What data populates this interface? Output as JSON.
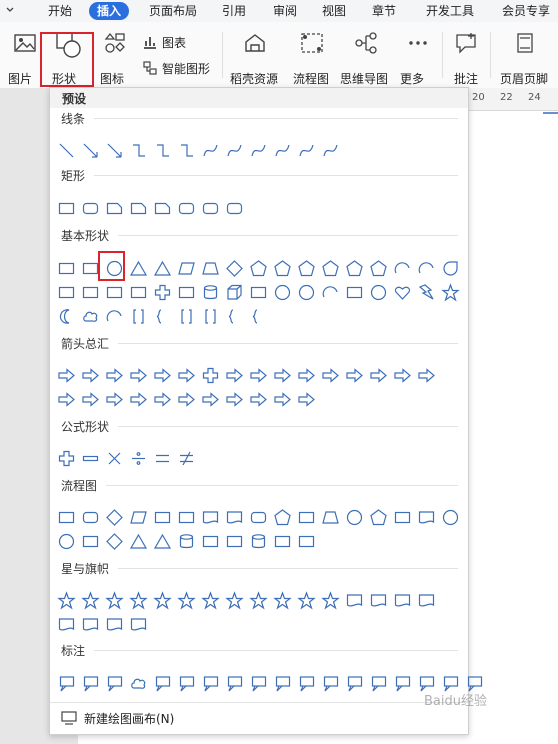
{
  "menu": {
    "tabs": [
      {
        "label": "开始",
        "active": false
      },
      {
        "label": "插入",
        "active": true
      },
      {
        "label": "页面布局",
        "active": false
      },
      {
        "label": "引用",
        "active": false
      },
      {
        "label": "审阅",
        "active": false
      },
      {
        "label": "视图",
        "active": false
      },
      {
        "label": "章节",
        "active": false
      },
      {
        "label": "开发工具",
        "active": false
      },
      {
        "label": "会员专享",
        "active": false
      }
    ]
  },
  "ribbon": {
    "picture": "图片",
    "shape": "形状",
    "icon": "图标",
    "chart": "图表",
    "smart": "智能图形",
    "daoke": "稻壳资源",
    "flow": "流程图",
    "mind": "思维导图",
    "more": "更多",
    "comment": "批注",
    "header_footer": "页眉页脚"
  },
  "ruler": {
    "ticks": [
      "20",
      "22",
      "24"
    ]
  },
  "panel": {
    "preset": "预设",
    "sections": [
      {
        "title": "线条",
        "icons": [
          "line",
          "arrow-line",
          "double-arrow-line",
          "elbow-connector",
          "elbow-arrow-connector",
          "elbow-double-arrow-connector",
          "curved-connector",
          "curved-arrow-connector",
          "curved-double-arrow-connector",
          "curve",
          "freeform",
          "scribble"
        ]
      },
      {
        "title": "矩形",
        "icons": [
          "rectangle",
          "rounded-rectangle",
          "snip-single-corner",
          "snip-same-side",
          "snip-diagonal",
          "round-single-corner",
          "round-same-side",
          "round-diagonal"
        ]
      },
      {
        "title": "基本形状",
        "icons": [
          "text-box",
          "vertical-text-box",
          "oval",
          "triangle",
          "right-triangle",
          "parallelogram",
          "trapezoid",
          "diamond",
          "pentagon",
          "hexagon",
          "heptagon",
          "octagon",
          "decagon",
          "dodecagon",
          "pie",
          "chord",
          "teardrop",
          "frame",
          "half-frame",
          "l-shape",
          "diagonal-stripe",
          "cross",
          "plaque",
          "can",
          "cube",
          "bevel",
          "donut",
          "no-symbol",
          "block-arc",
          "folded-corner",
          "smiley-face",
          "heart",
          "lightning-bolt",
          "sun",
          "moon",
          "cloud",
          "arc",
          "double-bracket",
          "double-brace",
          "left-bracket",
          "right-bracket",
          "left-brace",
          "right-brace"
        ]
      },
      {
        "title": "箭头总汇",
        "icons": [
          "right-arrow",
          "left-arrow",
          "up-arrow",
          "down-arrow",
          "left-right-arrow",
          "up-down-arrow",
          "quad-arrow",
          "left-right-up-arrow",
          "bent-arrow",
          "u-turn-arrow",
          "left-up-arrow",
          "bent-up-arrow",
          "curved-right-arrow",
          "curved-left-arrow",
          "curved-up-arrow",
          "curved-down-arrow",
          "striped-right-arrow",
          "notched-right-arrow",
          "pentagon-arrow",
          "chevron-arrow",
          "right-arrow-callout",
          "down-arrow-callout",
          "left-arrow-callout",
          "up-arrow-callout",
          "left-right-arrow-callout",
          "quad-arrow-callout",
          "circular-arrow"
        ]
      },
      {
        "title": "公式形状",
        "icons": [
          "plus",
          "minus",
          "multiply",
          "divide",
          "equal",
          "not-equal"
        ]
      },
      {
        "title": "流程图",
        "icons": [
          "process",
          "alternate-process",
          "decision",
          "data",
          "predefined-process",
          "internal-storage",
          "document",
          "multidocument",
          "terminator",
          "preparation",
          "manual-input",
          "manual-operation",
          "connector",
          "off-page-connector",
          "card",
          "punched-tape",
          "summing-junction",
          "or",
          "collate",
          "sort",
          "extract",
          "merge",
          "stored-data",
          "delay",
          "sequential-access-storage",
          "magnetic-disk",
          "direct-access-storage",
          "display"
        ]
      },
      {
        "title": "星与旗帜",
        "icons": [
          "explosion-1",
          "explosion-2",
          "star-4",
          "star-5",
          "star-6",
          "star-7",
          "star-8",
          "star-10",
          "star-12",
          "star-16",
          "star-24",
          "star-32",
          "ribbon-up",
          "ribbon-down",
          "curved-ribbon-up",
          "curved-ribbon-down",
          "vertical-scroll",
          "horizontal-scroll",
          "wave",
          "double-wave"
        ]
      },
      {
        "title": "标注",
        "icons": [
          "rect-callout",
          "rounded-rect-callout",
          "oval-callout",
          "cloud-callout",
          "line-callout-1",
          "line-callout-2",
          "line-callout-3",
          "line-callout-4",
          "accent-callout-1",
          "accent-callout-2",
          "accent-callout-3",
          "accent-callout-4",
          "border-callout-1",
          "border-callout-2",
          "border-callout-3",
          "border-callout-4",
          "accent-border-callout-1",
          "accent-border-callout-2"
        ]
      }
    ],
    "new_canvas": "新建绘图画布(N)"
  },
  "watermark": "Baidu经验",
  "colors": {
    "accent": "#2a6ee0",
    "shape_stroke": "#3d6fb6",
    "highlight": "#d9232d"
  }
}
